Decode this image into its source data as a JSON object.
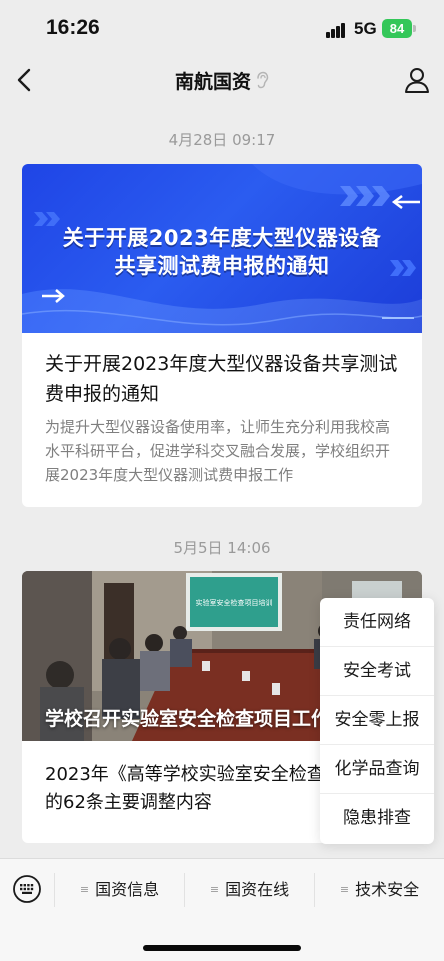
{
  "status_bar": {
    "time": "16:26",
    "network": "5G",
    "battery": "84",
    "battery_color": "#34c759"
  },
  "nav": {
    "title": "南航国资",
    "back_icon": "chevron-left-icon",
    "title_icon": "ear-icon",
    "profile_icon": "person-icon"
  },
  "messages": [
    {
      "timestamp": "4月28日 09:17",
      "banner_line1": "关于开展2023年度大型仪器设备",
      "banner_line2": "共享测试费申报的通知",
      "title": "关于开展2023年度大型仪器设备共享测试费申报的通知",
      "summary": "为提升大型仪器设备使用率，让师生充分利用我校高水平科研平台，促进学科交叉融合发展，学校组织开展2023年度大型仪器测试费申报工作"
    },
    {
      "timestamp": "5月5日 14:06",
      "photo_caption": "学校召开实验室安全检查项目工作会",
      "projector_text": "实验室安全检查项目培训",
      "body": "2023年《高等学校实验室安全检查项目表》的62条主要调整内容"
    }
  ],
  "popup_menu": {
    "items": [
      "责任网络",
      "安全考试",
      "安全零上报",
      "化学品查询",
      "隐患排查"
    ]
  },
  "tab_bar": {
    "keyboard_icon": "keyboard-icon",
    "menu_glyph": "≡",
    "tabs": [
      "国资信息",
      "国资在线",
      "技术安全"
    ]
  }
}
